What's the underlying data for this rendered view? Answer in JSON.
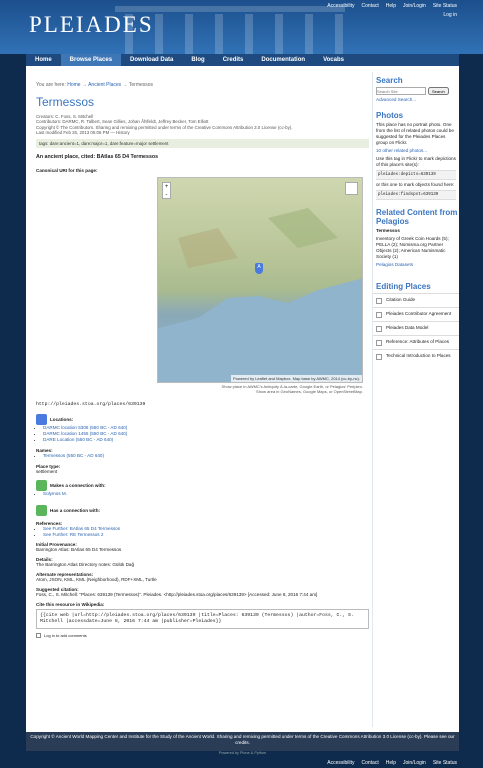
{
  "site": {
    "logo": "PLEIADES",
    "top_links": [
      "Accessibility",
      "Contact",
      "Help",
      "Join/Login",
      "Site Status"
    ],
    "login": "Log in"
  },
  "nav": [
    "Home",
    "Browse Places",
    "Download Data",
    "Blog",
    "Credits",
    "Documentation",
    "Vocabs"
  ],
  "crumb": {
    "prefix": "You are here:",
    "home": "Home",
    "places": "Ancient Places",
    "current": "Termessos"
  },
  "title": "Termessos",
  "meta": [
    "Creators: C. Foss, S. Mitchell",
    "Contributors: DARMC, R. Talbert, Sean Gillies, Johan Åhlfeldt, Jeffrey Becker, Tom Elliott",
    "Copyright © The Contributors. Sharing and remixing permitted under terms of the Creative Commons Attribution 3.0 License (cc-by).",
    "Last modified Feb 26, 2013 05:06 PM — History"
  ],
  "tags": "tags: dare:ancient=1, dare:major=1, dare:feature=major settlement",
  "description": "An ancient place, cited: BAtlas 65 D4 Termessos",
  "canonical_label": "Canonical URI for this page:",
  "uri": "http://pleiades.stoa.org/places/639139",
  "map": {
    "zoom_in": "+",
    "zoom_out": "-",
    "pin": "A",
    "attribution": "Powered by Leaflet and Mapbox. Map base by AWMC, 2014 (cc-by-nc).",
    "show1": "Show place in AWMC's Antiquity À-la-carte, Google Earth, or Pelagios' Peripleo.",
    "show2": "Show area in GeoNames, Google Maps, or OpenStreetMap."
  },
  "locations": {
    "label": "Locations:",
    "items": [
      "DARMC location 5306 (550 BC - AD 640)",
      "DARMC location 1455 (550 BC - AD 640)",
      "DARE Location (550 BC - AD 640)"
    ]
  },
  "names": {
    "label": "Names:",
    "items": [
      "Termessos (550 BC - AD 640)"
    ]
  },
  "place_type": {
    "label": "Place type:",
    "value": "settlement"
  },
  "connection": {
    "label": "Makes a connection with:",
    "items": [
      "Solymos M."
    ]
  },
  "has_connection": {
    "label": "Has a connection with:"
  },
  "references": {
    "label": "References:",
    "items": [
      "See Further: BAtlas 65 D4 Termessos",
      "See Further: RE Termessos 2"
    ]
  },
  "provenance": {
    "label": "Initial Provenance:",
    "value": "Barrington Atlas: BAtlas 65 D4 Termessos"
  },
  "details": {
    "label": "Details:",
    "value": "The Barrington Atlas Directory notes: Gülük Dağ"
  },
  "representations": {
    "label": "Alternate representations:",
    "value": "Atom, JSON, KML, KML (Neighborhood), RDF+XML, Turtle"
  },
  "citation": {
    "label": "Suggested citation:",
    "value": "Foss, C., S. Mitchell. \"Places: 639139 (Termessos)\". Pleiades. <http://pleiades.stoa.org/places/639139> [Accessed: June 8, 2016 7:44 am]"
  },
  "wiki": {
    "label": "Cite this resource in Wikipedia:",
    "code": "{{cite web |url=http://pleiades.stoa.org/places/639139 |title=Places: 639139 (Termessos) |author=Foss, C., S. Mitchell |accessdate=June 8, 2016 7:44 am |publisher=Pleiades}}"
  },
  "login_comments": "Log in to add comments",
  "sidebar": {
    "search_title": "Search",
    "search_placeholder": "Search Site",
    "search_button": "Search",
    "advanced": "Advanced Search...",
    "photos_title": "Photos",
    "photos_text": "This place has no portrait photo. One from the list of related photos could be suggested for the Pleiades Places group on Flickr.",
    "other_photos": "10 other related photos...",
    "flickr_text": "Use this tag in Flickr to mark depictions of this place's site(s):",
    "tag1": "pleiades:depicts=639139",
    "objects_text": "or this one to mark objects found here:",
    "tag2": "pleiades:findspot=639139",
    "related_title": "Related Content from Pelagios",
    "related_place": "Termessos",
    "related_text": "Inventory of Greek Coin Hoards (5); PELLA (2); Nomisma.org Partner Objects (2); American Numismatic Society (1)",
    "datasets": "Pelagios Datasets",
    "editing_title": "Editing Places",
    "editing": [
      "Citation Guide",
      "Pleiades Contributor Agreement",
      "Pleiades Data Model",
      "Reference: Attributes of Places",
      "Technical Introduction to Places"
    ]
  },
  "footer": "Copyright © Ancient World Mapping Center and Institute for the Study of the Ancient World. Sharing and remixing permitted under terms of the Creative Commons Attribution 3.0 License (cc-by). Please see our credits.",
  "powered": "Powered by Plone & Python"
}
